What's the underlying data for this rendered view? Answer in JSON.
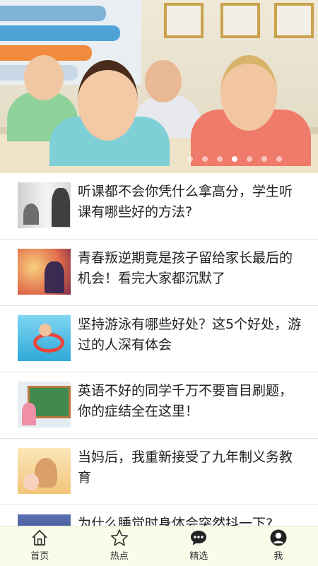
{
  "banner": {
    "slide_count": 7,
    "active_index": 3
  },
  "articles": [
    {
      "title": "听课都不会你凭什么拿高分，学生听课有哪些好的方法?",
      "thumb": "lecture-thumbnail"
    },
    {
      "title": "青春叛逆期竟是孩子留给家长最后的机会！看完大家都沉默了",
      "thumb": "teen-thumbnail"
    },
    {
      "title": "坚持游泳有哪些好处？这5个好处，游过的人深有体会",
      "thumb": "swimming-thumbnail"
    },
    {
      "title": "英语不好的同学千万不要盲目刷题，你的症结全在这里！",
      "thumb": "english-thumbnail"
    },
    {
      "title": "当妈后，我重新接受了九年制义务教育",
      "thumb": "mother-thumbnail"
    },
    {
      "title": "为什么睡觉时身体会突然抖一下?",
      "thumb": "sleep-thumbnail"
    }
  ],
  "tabbar": {
    "items": [
      {
        "label": "首页",
        "icon": "home-icon"
      },
      {
        "label": "热点",
        "icon": "star-icon"
      },
      {
        "label": "精选",
        "icon": "chat-icon"
      },
      {
        "label": "我",
        "icon": "user-icon"
      }
    ]
  },
  "colors": {
    "tabbar_bg": "#f7fde9",
    "text": "#222222",
    "divider": "#e3e3e3"
  }
}
